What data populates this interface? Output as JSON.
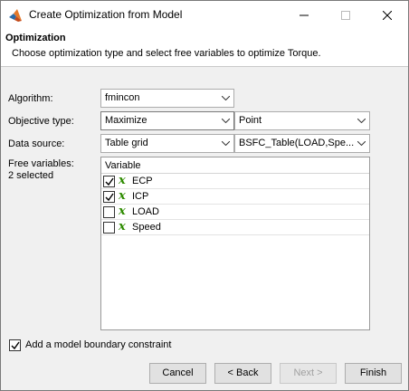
{
  "window": {
    "title": "Create Optimization from Model",
    "controls": {
      "minimize": "minimize",
      "maximize": "maximize",
      "close": "close"
    }
  },
  "header": {
    "title": "Optimization",
    "description": "Choose optimization type and select free variables to optimize Torque."
  },
  "form": {
    "algorithm": {
      "label": "Algorithm:",
      "value": "fmincon"
    },
    "objective_type": {
      "label": "Objective type:",
      "value": "Maximize",
      "secondary_value": "Point"
    },
    "data_source": {
      "label": "Data source:",
      "value": "Table grid",
      "secondary_value": "BSFC_Table(LOAD,Spe..."
    },
    "free_variables": {
      "label": "Free variables:",
      "count_text": "2 selected"
    }
  },
  "variables_table": {
    "header": "Variable",
    "rows": [
      {
        "name": "ECP",
        "checked": true,
        "icon": "x-variable-icon",
        "symbol": "x"
      },
      {
        "name": "ICP",
        "checked": true,
        "icon": "x-variable-icon",
        "symbol": "x"
      },
      {
        "name": "LOAD",
        "checked": false,
        "icon": "x-variable-icon",
        "symbol": "x"
      },
      {
        "name": "Speed",
        "checked": false,
        "icon": "x-variable-icon",
        "symbol": "x"
      }
    ]
  },
  "boundary_constraint": {
    "label": "Add a model boundary constraint",
    "checked": true
  },
  "buttons": {
    "cancel": "Cancel",
    "back": "< Back",
    "next": "Next >",
    "finish": "Finish"
  },
  "colors": {
    "variable_icon": "#2e8b00",
    "disabled_text": "#a0a0a0"
  }
}
